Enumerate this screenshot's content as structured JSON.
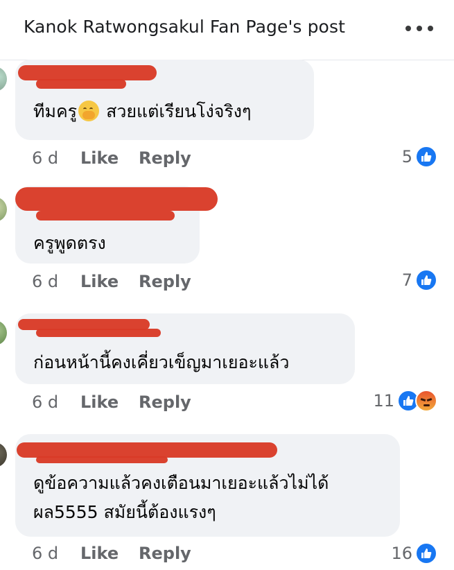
{
  "header": {
    "title": "Kanok Ratwongsakul Fan Page's post",
    "more_icon": "more-horizontal-icon"
  },
  "comments": [
    {
      "author": "",
      "text_lines": [
        "ทีมครู",
        "สวยแต่เรียนโง่จริงๆ"
      ],
      "has_emoji": "face-with-hand-over-mouth",
      "age": "6 d",
      "like_label": "Like",
      "reply_label": "Reply",
      "reaction_count": "5",
      "reactions": [
        "like"
      ]
    },
    {
      "author": "",
      "text_lines": [
        "ครูพูดตรง"
      ],
      "age": "6 d",
      "like_label": "Like",
      "reply_label": "Reply",
      "reaction_count": "7",
      "reactions": [
        "like"
      ]
    },
    {
      "author": "",
      "text_lines": [
        "ก่อนหน้านี้คงเคี่ยวเข็ญมาเยอะแล้ว"
      ],
      "age": "6 d",
      "like_label": "Like",
      "reply_label": "Reply",
      "reaction_count": "11",
      "reactions": [
        "like",
        "angry"
      ]
    },
    {
      "author": "",
      "text_lines": [
        "ดูข้อความแล้วคงเตือนมาเยอะแล้วไม่ได้",
        "ผล5555 สมัยนี้ต้องแรงๆ"
      ],
      "age": "6 d",
      "like_label": "Like",
      "reply_label": "Reply",
      "reaction_count": "16",
      "reactions": [
        "like"
      ]
    }
  ],
  "colors": {
    "bubble": "#f0f2f5",
    "meta": "#65676b",
    "like_blue": "#1877f2",
    "redaction": "#d83a26"
  }
}
